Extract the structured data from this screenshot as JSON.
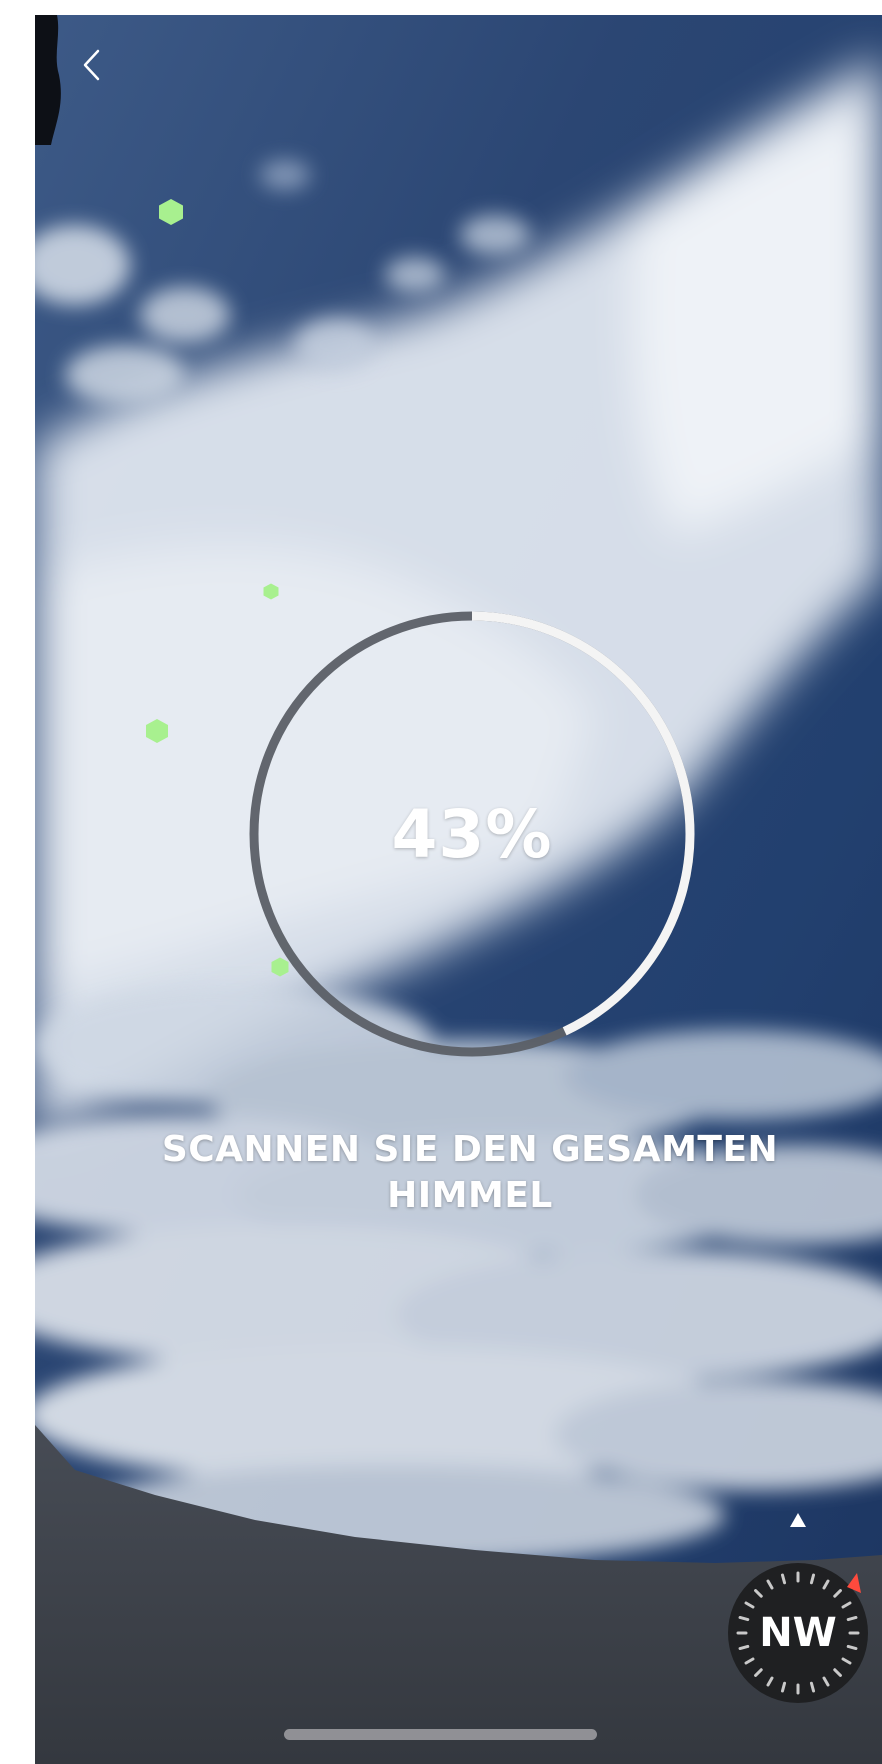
{
  "header": {
    "back_icon": "chevron-left-icon"
  },
  "scan": {
    "progress_label": "43%",
    "progress_fraction": 0.43,
    "instruction": "SCANNEN SIE DEN GESAMTEN HIMMEL"
  },
  "compass": {
    "direction": "NW",
    "icon": "compass-icon",
    "heading_indicator_color": "#ff4a3d"
  },
  "markers": {
    "color": "#a8f08f",
    "icon": "hexagon-marker-icon"
  },
  "colors": {
    "progress_done": "#f4f4f4",
    "progress_remaining": "#5b5f66",
    "sky_dark": "#1f3a66",
    "ground": "#3c4149"
  }
}
